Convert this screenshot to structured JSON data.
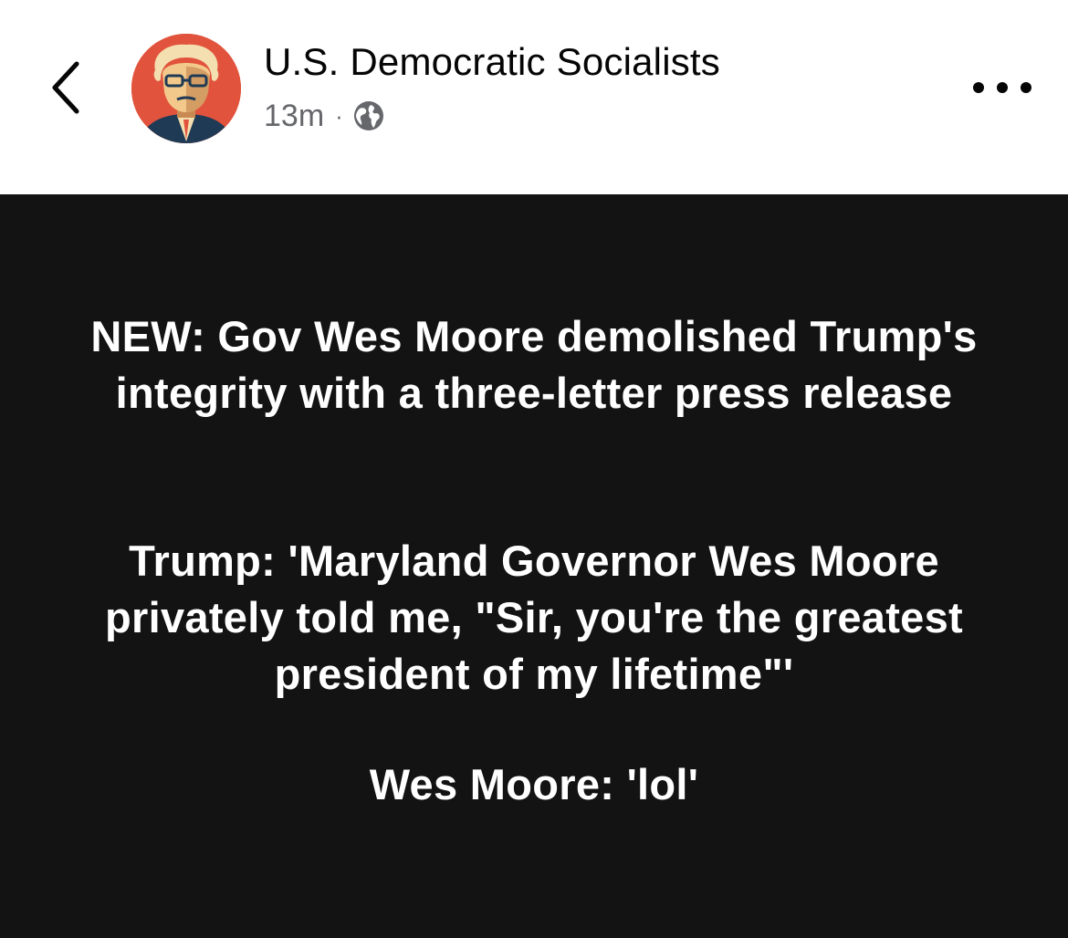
{
  "header": {
    "page_name": "U.S. Democratic Socialists",
    "timestamp": "13m",
    "separator": "·",
    "audience_icon": "globe-icon",
    "back_icon": "chevron-left-icon",
    "more_icon": "more-horizontal-icon"
  },
  "post": {
    "background_color": "#131313",
    "text_color": "#ffffff",
    "paragraphs": [
      "NEW: Gov Wes Moore demolished Trump's integrity with a three-letter press release",
      "Trump: 'Maryland Governor Wes Moore privately told me, \"Sir, you're the greatest president of my lifetime\"'",
      "Wes Moore: 'lol'"
    ]
  },
  "colors": {
    "avatar_background": "#e1533c",
    "meta_text": "#65676b"
  }
}
